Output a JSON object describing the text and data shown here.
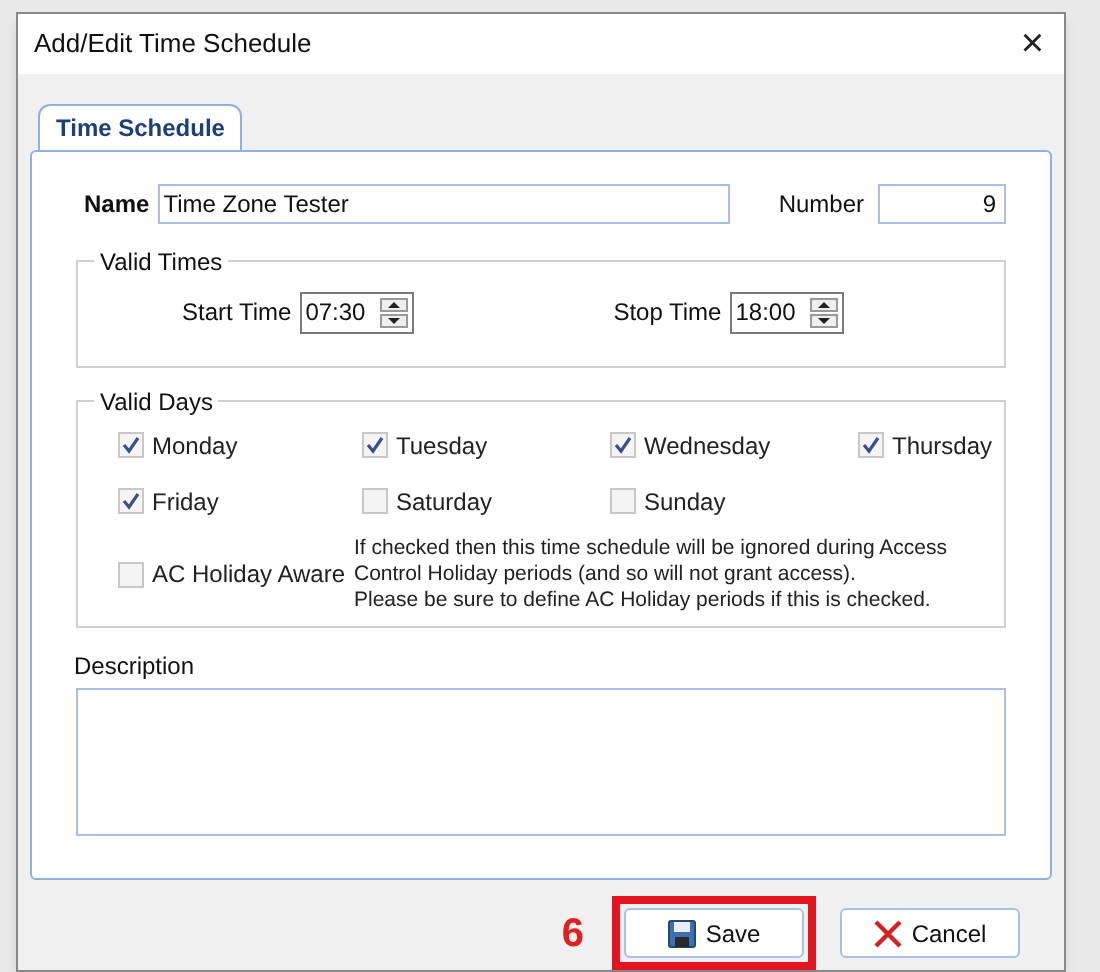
{
  "window": {
    "title": "Add/Edit Time Schedule",
    "close": "×"
  },
  "tabs": [
    {
      "label": "Time Schedule",
      "selected": true
    }
  ],
  "name": {
    "label": "Name",
    "value": "Time Zone Tester"
  },
  "number": {
    "label": "Number",
    "value": "9"
  },
  "valid_times": {
    "title": "Valid Times",
    "fields": [
      {
        "label": "Start Time",
        "value": "07:30"
      },
      {
        "label": "Stop Time",
        "value": "18:00"
      }
    ]
  },
  "valid_days": {
    "title": "Valid Days",
    "days": [
      {
        "label": "Monday",
        "checked": true
      },
      {
        "label": "Tuesday",
        "checked": true
      },
      {
        "label": "Wednesday",
        "checked": true
      },
      {
        "label": "Thursday",
        "checked": true
      },
      {
        "label": "Friday",
        "checked": true
      },
      {
        "label": "Saturday",
        "checked": false
      },
      {
        "label": "Sunday",
        "checked": false
      }
    ],
    "holiday": {
      "label": "AC Holiday Aware",
      "checked": false,
      "note": [
        "If checked then this time schedule will be ignored during Access",
        "Control Holiday periods (and so will not grant access).",
        "Please be sure to define AC Holiday periods if this is checked."
      ]
    }
  },
  "description": {
    "label": "Description"
  },
  "callout": {
    "step": "6"
  },
  "buttons": [
    {
      "kind": "save",
      "label": "Save",
      "highlighted": true
    },
    {
      "kind": "cancel",
      "label": "Cancel",
      "highlighted": false
    }
  ]
}
